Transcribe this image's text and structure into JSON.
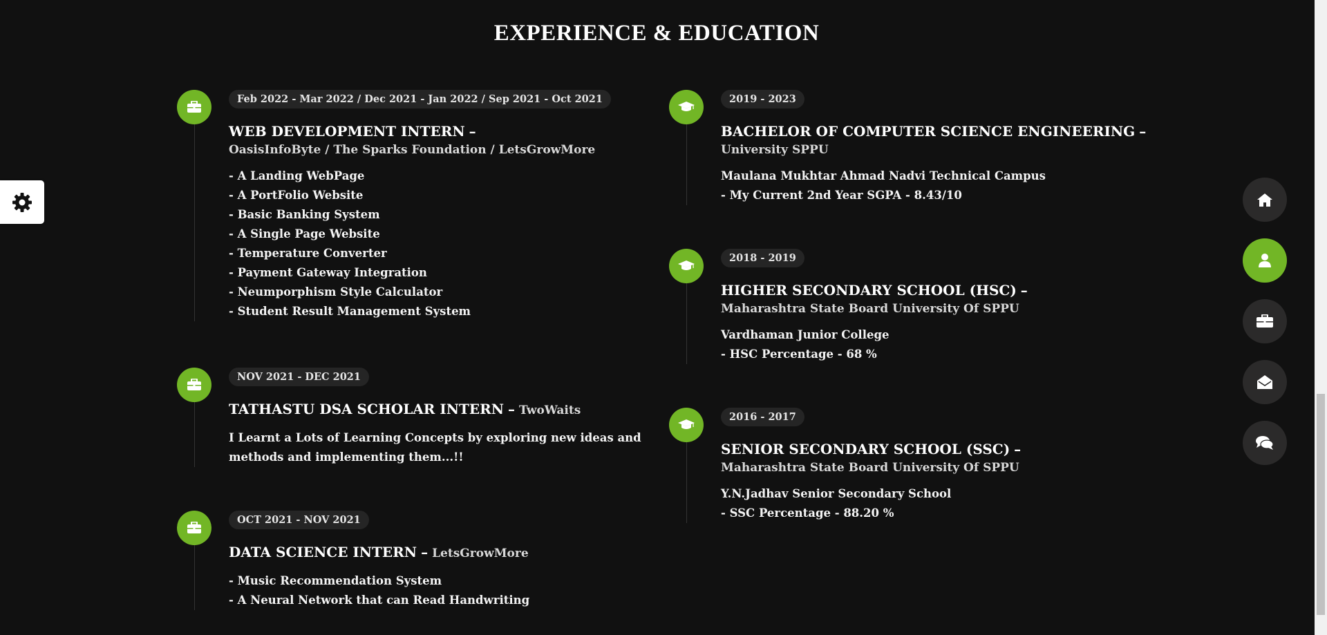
{
  "section": {
    "title": "EXPERIENCE & EDUCATION"
  },
  "experience": [
    {
      "date": "Feb 2022 - Mar 2022 / Dec 2021 - Jan 2022 / Sep 2021 - Oct 2021",
      "title": "WEB DEVELOPMENT INTERN",
      "org": "OasisInfoByte / The Sparks Foundation / LetsGrowMore",
      "lines": [
        "- A Landing WebPage",
        "- A PortFolio Website",
        "- Basic Banking System",
        "- A Single Page Website",
        "- Temperature Converter",
        "- Payment Gateway Integration",
        "- Neumporphism Style Calculator",
        "- Student Result Management System"
      ]
    },
    {
      "date": "NOV 2021 - DEC 2021",
      "title": "TATHASTU DSA SCHOLAR INTERN",
      "org": "TwoWaits",
      "description": "I Learnt a Lots of Learning Concepts by exploring new ideas and methods and implementing them...!!"
    },
    {
      "date": "OCT 2021 - NOV 2021",
      "title": "DATA SCIENCE INTERN",
      "org": "LetsGrowMore",
      "lines": [
        "- Music Recommendation System",
        "- A Neural Network that can Read Handwriting"
      ]
    }
  ],
  "education": [
    {
      "date": "2019 - 2023",
      "title": "BACHELOR OF COMPUTER SCIENCE ENGINEERING",
      "org": "University SPPU",
      "lines": [
        "Maulana Mukhtar Ahmad Nadvi Technical Campus",
        "- My Current 2nd Year SGPA - 8.43/10"
      ]
    },
    {
      "date": "2018 - 2019",
      "title": "HIGHER SECONDARY SCHOOL (HSC)",
      "org": "Maharashtra State Board University Of SPPU",
      "lines": [
        "Vardhaman Junior College",
        "- HSC Percentage - 68 %"
      ]
    },
    {
      "date": "2016 - 2017",
      "title": "SENIOR SECONDARY SCHOOL (SSC)",
      "org": "Maharashtra State Board University Of SPPU",
      "lines": [
        "Y.N.Jadhav Senior Secondary School",
        "- SSC Percentage - 88.20 %"
      ]
    }
  ],
  "icons": {
    "experience": "briefcase-icon",
    "education": "graduation-cap-icon",
    "settings": "gear-icon",
    "nav": [
      "home-icon",
      "user-icon",
      "briefcase-icon",
      "envelope-open-icon",
      "comments-icon"
    ]
  },
  "colors": {
    "background": "#111111",
    "accent": "#72b626",
    "badge": "#252525",
    "nav_inactive": "#2b2a2a"
  },
  "nav": {
    "active_index": 1
  }
}
